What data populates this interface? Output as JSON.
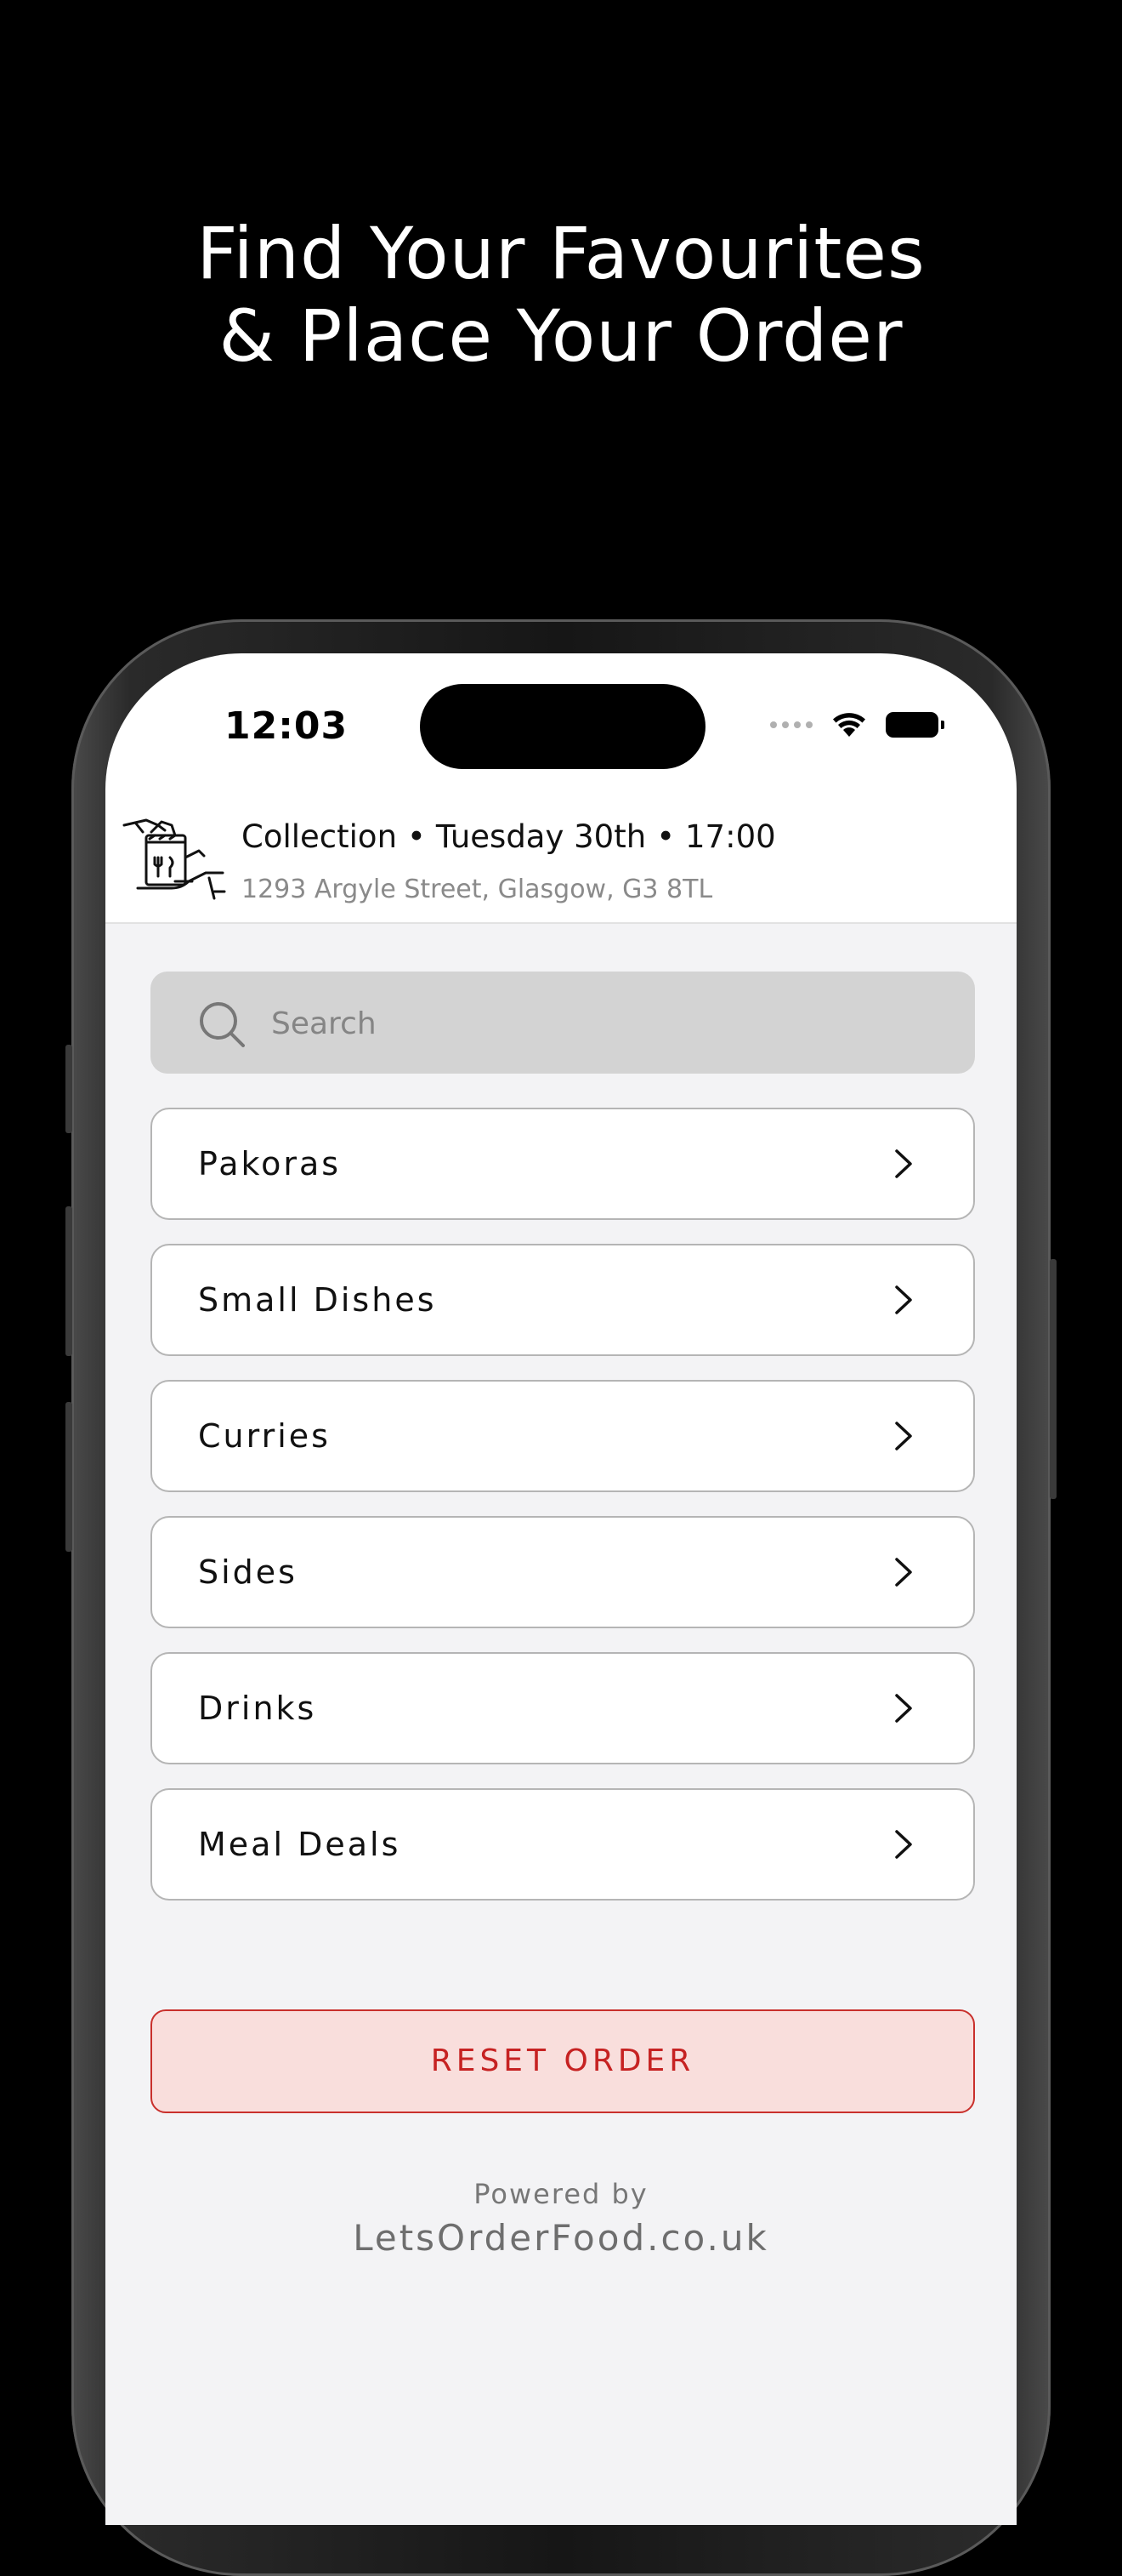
{
  "promo": {
    "line1": "Find Your Favourites",
    "line2": "& Place Your Order"
  },
  "status_bar": {
    "time": "12:03"
  },
  "order_header": {
    "mode": "Collection",
    "day": "Tuesday 30th",
    "time": "17:00",
    "separator": "•",
    "address": "1293 Argyle Street, Glasgow, G3 8TL",
    "icon": "collection-bag-icon"
  },
  "search": {
    "placeholder": "Search"
  },
  "categories": [
    {
      "label": "Pakoras"
    },
    {
      "label": "Small Dishes"
    },
    {
      "label": "Curries"
    },
    {
      "label": "Sides"
    },
    {
      "label": "Drinks"
    },
    {
      "label": "Meal Deals"
    }
  ],
  "reset_button": {
    "label": "RESET ORDER"
  },
  "footer": {
    "powered_by": "Powered by",
    "site": "LetsOrderFood.co.uk"
  },
  "colors": {
    "accent_red": "#c62222",
    "reset_bg": "#f9dedc",
    "content_bg": "#f3f3f5",
    "search_bg": "#d3d3d3"
  }
}
